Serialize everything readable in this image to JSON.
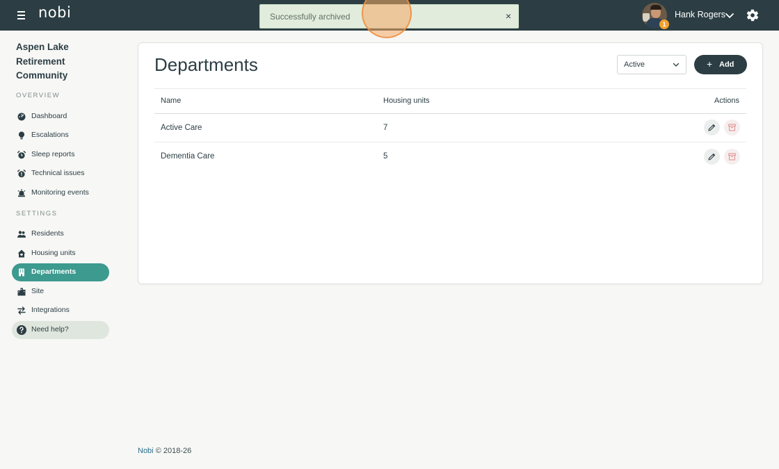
{
  "topbar": {
    "logo": "nobi",
    "toast_message": "Successfully archived",
    "toast_close": "×",
    "user_name": "Hank Rogers",
    "notification_count": "1"
  },
  "sidebar": {
    "org_name": "Aspen Lake Retirement Community",
    "overview_label": "OVERVIEW",
    "overview_items": [
      {
        "label": "Dashboard",
        "icon": "dashboard-icon"
      },
      {
        "label": "Escalations",
        "icon": "lightbulb-icon"
      },
      {
        "label": "Sleep reports",
        "icon": "alarm-clock-icon"
      },
      {
        "label": "Technical issues",
        "icon": "alarm-clock-warning-icon"
      },
      {
        "label": "Monitoring events",
        "icon": "monitoring-icon"
      }
    ],
    "settings_label": "SETTINGS",
    "settings_items": [
      {
        "label": "Residents",
        "icon": "users-icon"
      },
      {
        "label": "Housing units",
        "icon": "house-icon"
      },
      {
        "label": "Departments",
        "icon": "building-icon",
        "active": true
      },
      {
        "label": "Site",
        "icon": "city-icon"
      },
      {
        "label": "Integrations",
        "icon": "arrows-exchange-icon"
      }
    ],
    "help_label": "Need help?"
  },
  "main": {
    "title": "Departments",
    "filter_value": "Active",
    "add_label": "Add",
    "columns": [
      "Name",
      "Housing units",
      "Actions"
    ],
    "rows": [
      {
        "name": "Active Care",
        "housing_units": "7"
      },
      {
        "name": "Dementia Care",
        "housing_units": "5"
      }
    ]
  },
  "footer": {
    "brand": "Nobi",
    "copyright": "© 2018-26"
  },
  "colors": {
    "topbar": "#2c3e44",
    "accent": "#3c9a8f",
    "toast_bg": "#e1ecdd",
    "background": "#f7f7f5"
  }
}
